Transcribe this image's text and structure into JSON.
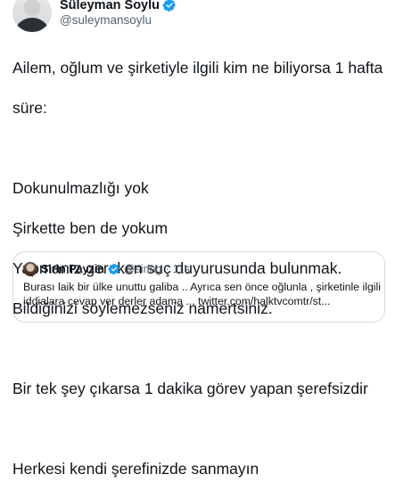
{
  "author": {
    "display_name": "Süleyman Soylu",
    "handle": "@suleymansoylu",
    "verified_color": "#1d9bf0"
  },
  "tweet": {
    "lines": [
      "Ailem, oğlum ve şirketiyle ilgili kim ne biliyorsa 1 hafta",
      "süre:",
      "Dokunulmazlığı yok",
      "Şirkette ben de yokum",
      "Yapmanız gereken suç duyurusunda bulunmak.",
      "Bildiğinizi söylemezseniz namertsiniz.",
      "Bir tek şey çıkarsa 1 dakika görev yapan şerefsizdir",
      "Herkesi kendi şerefinizde sanmayın"
    ]
  },
  "quote": {
    "display_name": "Sirin Payzin",
    "handle": "@siring",
    "separator": "·",
    "time": "11s",
    "lines": [
      "Burası laik bir ülke unuttu galiba .. Ayrıca sen önce oğlunla , şirketinle ilgili",
      "iddialara cevap ver derler adama ... twitter.com/halktvcomtr/st..."
    ]
  }
}
